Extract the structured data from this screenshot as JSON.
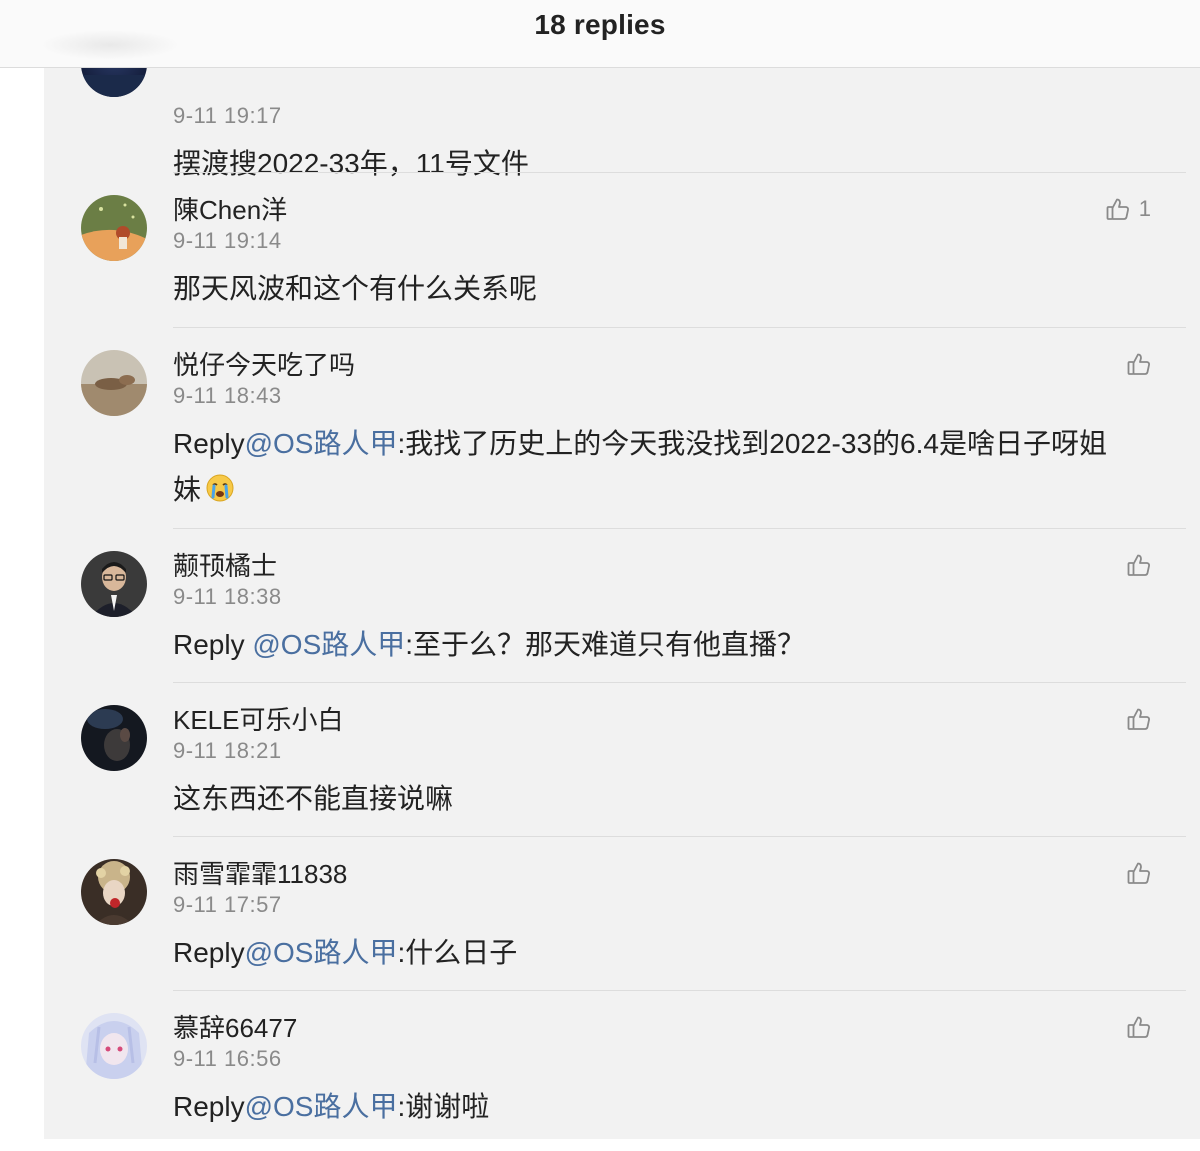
{
  "header": {
    "title": "18 replies"
  },
  "comments": [
    {
      "name": "",
      "time": "9-11 19:17",
      "text": "摆渡搜2022-33年，11号文件",
      "likes": ""
    },
    {
      "name": "陳Chen洋",
      "time": "9-11 19:14",
      "text": "那天风波和这个有什么关系呢",
      "likes": "1"
    },
    {
      "name": "悦仔今天吃了吗",
      "time": "9-11 18:43",
      "reply_prefix": "Reply",
      "mention": "@OS路人甲",
      "text": ":我找了历史上的今天我没找到2022-33的6.4是啥日子呀姐妹",
      "emoji": "crying-face",
      "likes": ""
    },
    {
      "name": "颟顸橘士",
      "time": "9-11 18:38",
      "reply_prefix": "Reply ",
      "mention": "@OS路人甲",
      "text": ":至于么？那天难道只有他直播？",
      "likes": ""
    },
    {
      "name": "KELE可乐小白",
      "time": "9-11 18:21",
      "text": "这东西还不能直接说嘛",
      "likes": ""
    },
    {
      "name": "雨雪霏霏11838",
      "time": "9-11 17:57",
      "reply_prefix": "Reply",
      "mention": "@OS路人甲",
      "text": ":什么日子",
      "likes": ""
    },
    {
      "name": "慕辞66477",
      "time": "9-11 16:56",
      "reply_prefix": "Reply",
      "mention": "@OS路人甲",
      "text": ":谢谢啦",
      "likes": ""
    }
  ],
  "icons": {
    "like": "thumbs-up-icon"
  },
  "colors": {
    "mention": "#4a6fa0",
    "panel": "#f2f2f2",
    "time": "#8a8a8a"
  }
}
